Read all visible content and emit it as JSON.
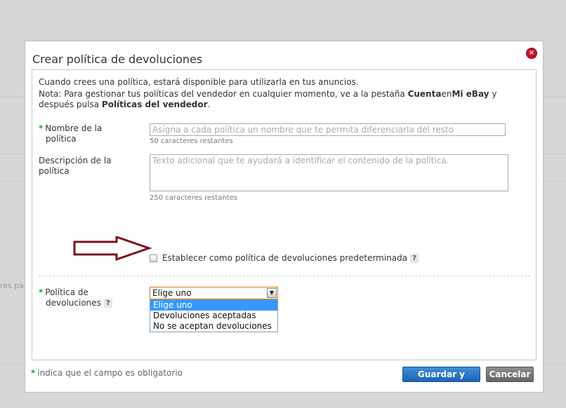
{
  "background": {
    "side_text": "res par"
  },
  "dialog": {
    "title": "Crear política de devoluciones",
    "close_label": "×",
    "intro": {
      "line1": "Cuando crees una política, estará disponible para utilizarla en tus anuncios.",
      "note_prefix": "Nota: Para gestionar tus políticas del vendedor en cualquier momento, ve a la pestaña ",
      "note_cuenta": "Cuenta",
      "note_en": "en",
      "note_miebay": "Mi eBay",
      "note_middle": " y después pulsa ",
      "note_politicas": "Políticas del vendedor",
      "note_end": "."
    },
    "fields": {
      "required_mark": "*",
      "name_label_1": "Nombre de la",
      "name_label_2": "política",
      "name_placeholder": "Asigna a cada política un nombre que te permita diferenciarla del resto",
      "name_helper": "50 caracteres restantes",
      "desc_label_1": "Descripción de la",
      "desc_label_2": "política",
      "desc_placeholder": "Texto adicional que te ayudará a identificar el contenido de la política.",
      "desc_helper": "250 caracteres restantes",
      "default_checkbox_label": "Establecer como política de devoluciones predeterminada",
      "help_mark": "?",
      "policy_label_1": "Política de",
      "policy_label_2": "devoluciones",
      "policy_selected": "Elige uno",
      "policy_options": [
        "Elige uno",
        "Devoluciones aceptadas",
        "No se aceptan devoluciones"
      ],
      "select_arrow": "▼"
    },
    "footer": {
      "required_note": "indica que el campo es obligatorio",
      "save_label": "Guardar y cerrar",
      "cancel_label": "Cancelar"
    }
  },
  "colors": {
    "required": "#2e9e2e",
    "primary_button": "#1d64b4",
    "close_button": "#c8102e",
    "arrow": "#7a1420",
    "option_highlight": "#3399ff"
  }
}
